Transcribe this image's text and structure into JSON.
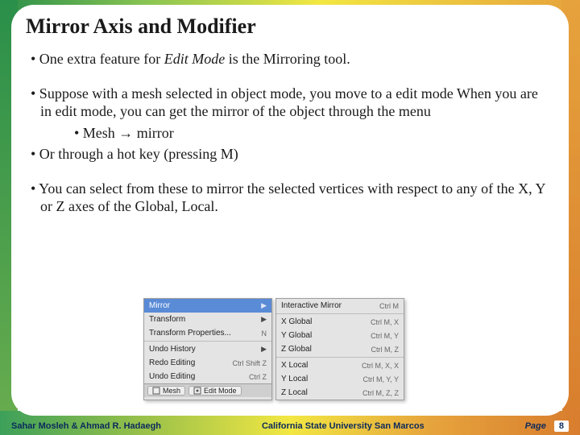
{
  "title": "Mirror Axis and Modifier",
  "bullets": {
    "b1_pre": "• One extra feature for ",
    "b1_em": "Edit Mode",
    "b1_post": " is the Mirroring tool.",
    "b2": "• Suppose with a mesh selected in object mode, you move to a edit mode When you are in edit mode, you can get the mirror of the object through the menu",
    "b2a": "• Mesh → mirror",
    "b3": "• Or through a hot key (pressing M)",
    "b4": "• You can select from these to mirror the selected vertices with respect to any of the X, Y or Z axes of the Global, Local."
  },
  "menu_left": {
    "rows": [
      {
        "label": "Mirror",
        "arrow": true,
        "sc": ""
      },
      {
        "label": "Transform",
        "arrow": true,
        "sc": ""
      },
      {
        "label": "Transform Properties...",
        "arrow": false,
        "sc": "N"
      },
      {
        "sep": true
      },
      {
        "label": "Undo History",
        "arrow": true,
        "sc": ""
      },
      {
        "label": "Redo Editing",
        "arrow": false,
        "sc": "Ctrl Shift Z"
      },
      {
        "label": "Undo Editing",
        "arrow": false,
        "sc": "Ctrl Z"
      }
    ],
    "footer_mesh": "Mesh",
    "footer_mode": "Edit Mode"
  },
  "menu_right": {
    "rows": [
      {
        "label": "Interactive Mirror",
        "sc": "Ctrl M"
      },
      {
        "sep": true
      },
      {
        "label": "X Global",
        "sc": "Ctrl M, X"
      },
      {
        "label": "Y Global",
        "sc": "Ctrl M, Y"
      },
      {
        "label": "Z Global",
        "sc": "Ctrl M, Z"
      },
      {
        "sep": true
      },
      {
        "label": "X Local",
        "sc": "Ctrl M, X, X"
      },
      {
        "label": "Y Local",
        "sc": "Ctrl M, Y, Y"
      },
      {
        "label": "Z Local",
        "sc": "Ctrl M, Z, Z"
      }
    ]
  },
  "footer": {
    "authors": "Sahar Mosleh & Ahmad R. Hadaegh",
    "org": "California State University San Marcos",
    "page_label": "Page",
    "page_num": "8"
  }
}
